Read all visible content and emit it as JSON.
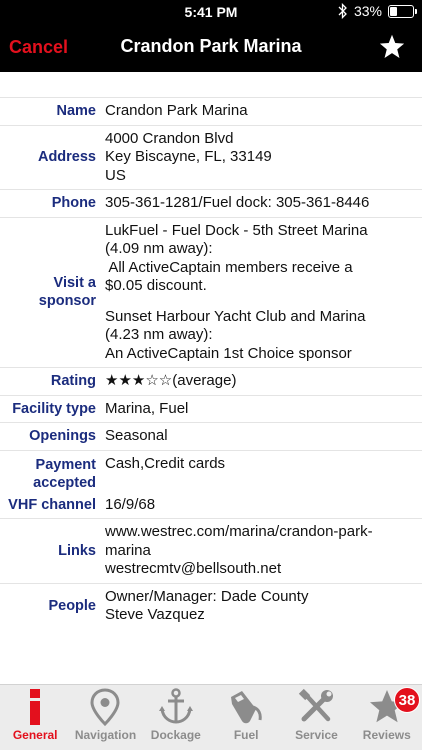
{
  "status_bar": {
    "time": "5:41 PM",
    "battery": "33%",
    "battery_level": 0.33
  },
  "nav": {
    "cancel": "Cancel",
    "title": "Crandon Park Marina"
  },
  "details": {
    "name": {
      "label": "Name",
      "lines": [
        "Crandon Park Marina"
      ]
    },
    "address": {
      "label": "Address",
      "lines": [
        "4000 Crandon Blvd",
        "Key Biscayne, FL, 33149",
        "US"
      ]
    },
    "phone": {
      "label": "Phone",
      "lines": [
        "305-361-1281/Fuel dock: 305-361-8446"
      ]
    },
    "sponsor": {
      "label_lines": [
        "Visit a",
        "sponsor"
      ],
      "entries": [
        [
          "LukFuel - Fuel Dock - 5th Street Marina",
          "(4.09 nm away):",
          " All ActiveCaptain members receive a",
          "$0.05 discount."
        ],
        [
          "Sunset Harbour Yacht Club and Marina",
          "(4.23 nm away):",
          "An ActiveCaptain 1st Choice sponsor"
        ]
      ]
    },
    "rating": {
      "label": "Rating",
      "value": "★★★☆☆(average)",
      "stars": 3,
      "max": 5
    },
    "facility_type": {
      "label": "Facility type",
      "value": "Marina, Fuel"
    },
    "openings": {
      "label": "Openings",
      "value": "Seasonal"
    },
    "payment": {
      "label_lines": [
        "Payment",
        "accepted"
      ],
      "value": "Cash,Credit cards"
    },
    "vhf": {
      "label": "VHF channel",
      "value": "16/9/68"
    },
    "links": {
      "label": "Links",
      "lines": [
        "www.westrec.com/marina/crandon-park-",
        "marina",
        "westrecmtv@bellsouth.net"
      ]
    },
    "people": {
      "label": "People",
      "lines": [
        "Owner/Manager: Dade County",
        "Steve Vazquez"
      ]
    }
  },
  "tabs": [
    {
      "label": "General",
      "icon": "info-icon"
    },
    {
      "label": "Navigation",
      "icon": "map-pin-icon"
    },
    {
      "label": "Dockage",
      "icon": "anchor-icon"
    },
    {
      "label": "Fuel",
      "icon": "fuel-pump-icon"
    },
    {
      "label": "Service",
      "icon": "tools-icon"
    },
    {
      "label": "Reviews",
      "icon": "star-icon",
      "badge": "38"
    }
  ],
  "colors": {
    "accent": "#e3101d",
    "label": "#1b2c7e",
    "nav_bg": "#000000",
    "tab_bg": "#ececec",
    "inactive": "#8c8c8c"
  }
}
